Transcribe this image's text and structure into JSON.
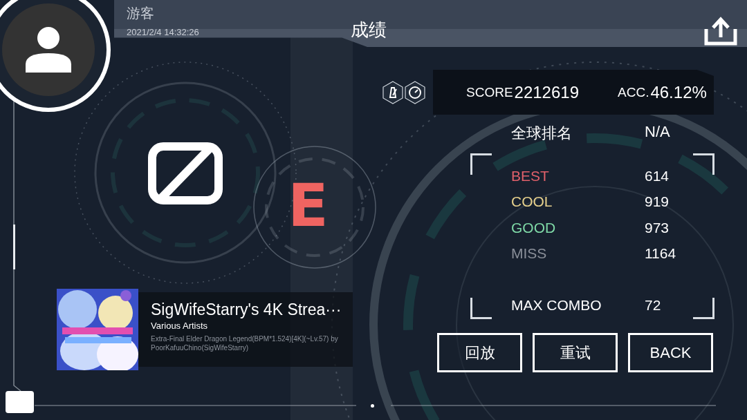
{
  "player": {
    "name": "游客",
    "timestamp": "2021/2/4 14:32:26"
  },
  "title": "成绩",
  "mods": [
    {
      "kind": "metronome"
    },
    {
      "kind": "speedometer"
    }
  ],
  "score": {
    "label": "SCORE",
    "value": "2212619"
  },
  "accuracy": {
    "label": "ACC.",
    "value": "46.12%"
  },
  "ranking": {
    "label": "全球排名",
    "value": "N/A"
  },
  "judgements": [
    {
      "label": "BEST",
      "value": "614",
      "color": "#e0606a"
    },
    {
      "label": "COOL",
      "value": "919",
      "color": "#e6d08c"
    },
    {
      "label": "GOOD",
      "value": "973",
      "color": "#7ed8a6"
    },
    {
      "label": "MISS",
      "value": "1164",
      "color": "#8a8f99"
    }
  ],
  "max_combo": {
    "label": "MAX COMBO",
    "value": "72"
  },
  "grade": "E",
  "song": {
    "title": "SigWifeStarry's 4K Strea···",
    "artist": "Various Artists",
    "chart": "Extra-Final Elder Dragon Legend(BPM*1.524)[4K](~Lv.57) by PoorKafuuChino(SigWifeStarry)"
  },
  "buttons": [
    "回放",
    "重试",
    "BACK"
  ]
}
